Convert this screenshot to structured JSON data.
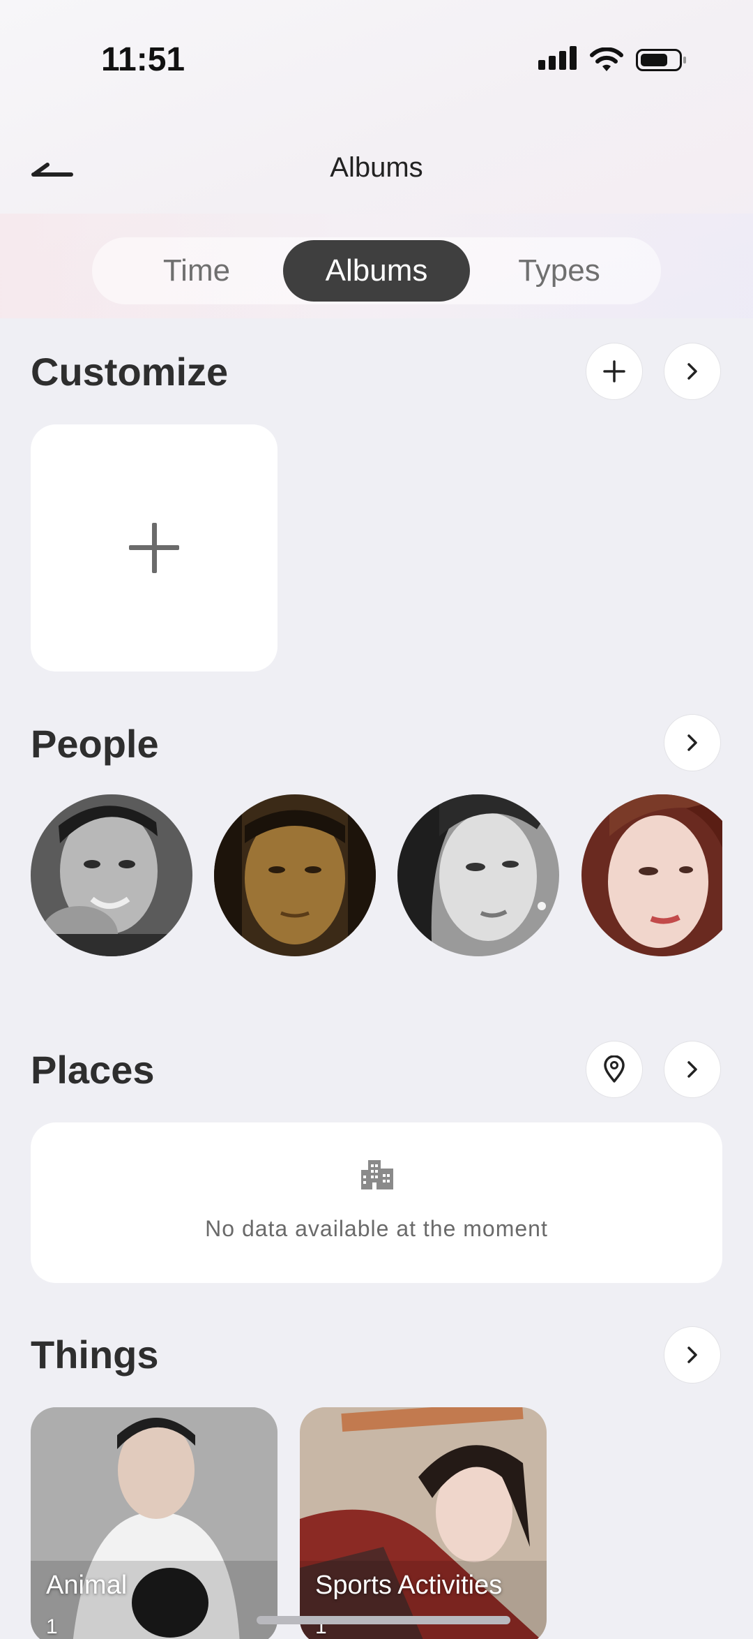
{
  "status_bar": {
    "time": "11:51",
    "icons": [
      "cellular-signal-icon",
      "wifi-icon",
      "battery-icon"
    ]
  },
  "nav": {
    "back_icon": "back-arrow-icon",
    "title": "Albums"
  },
  "tabs": [
    {
      "label": "Time",
      "active": false
    },
    {
      "label": "Albums",
      "active": true
    },
    {
      "label": "Types",
      "active": false
    }
  ],
  "customize": {
    "title": "Customize",
    "actions": [
      "plus-icon",
      "chevron-right-icon"
    ],
    "add_tile_icon": "plus-icon"
  },
  "people": {
    "title": "People",
    "actions": [
      "chevron-right-icon"
    ],
    "count_visible": 4
  },
  "places": {
    "title": "Places",
    "actions": [
      "location-pin-icon",
      "chevron-right-icon"
    ],
    "empty_icon": "building-icon",
    "empty_text": "No data available at the moment"
  },
  "things": {
    "title": "Things",
    "actions": [
      "chevron-right-icon"
    ],
    "items": [
      {
        "label": "Animal",
        "count": "1"
      },
      {
        "label": "Sports Activities",
        "count": "1"
      }
    ]
  },
  "colors": {
    "background": "#efeff4",
    "active_tab": "#3f3f3f",
    "card": "#ffffff"
  }
}
